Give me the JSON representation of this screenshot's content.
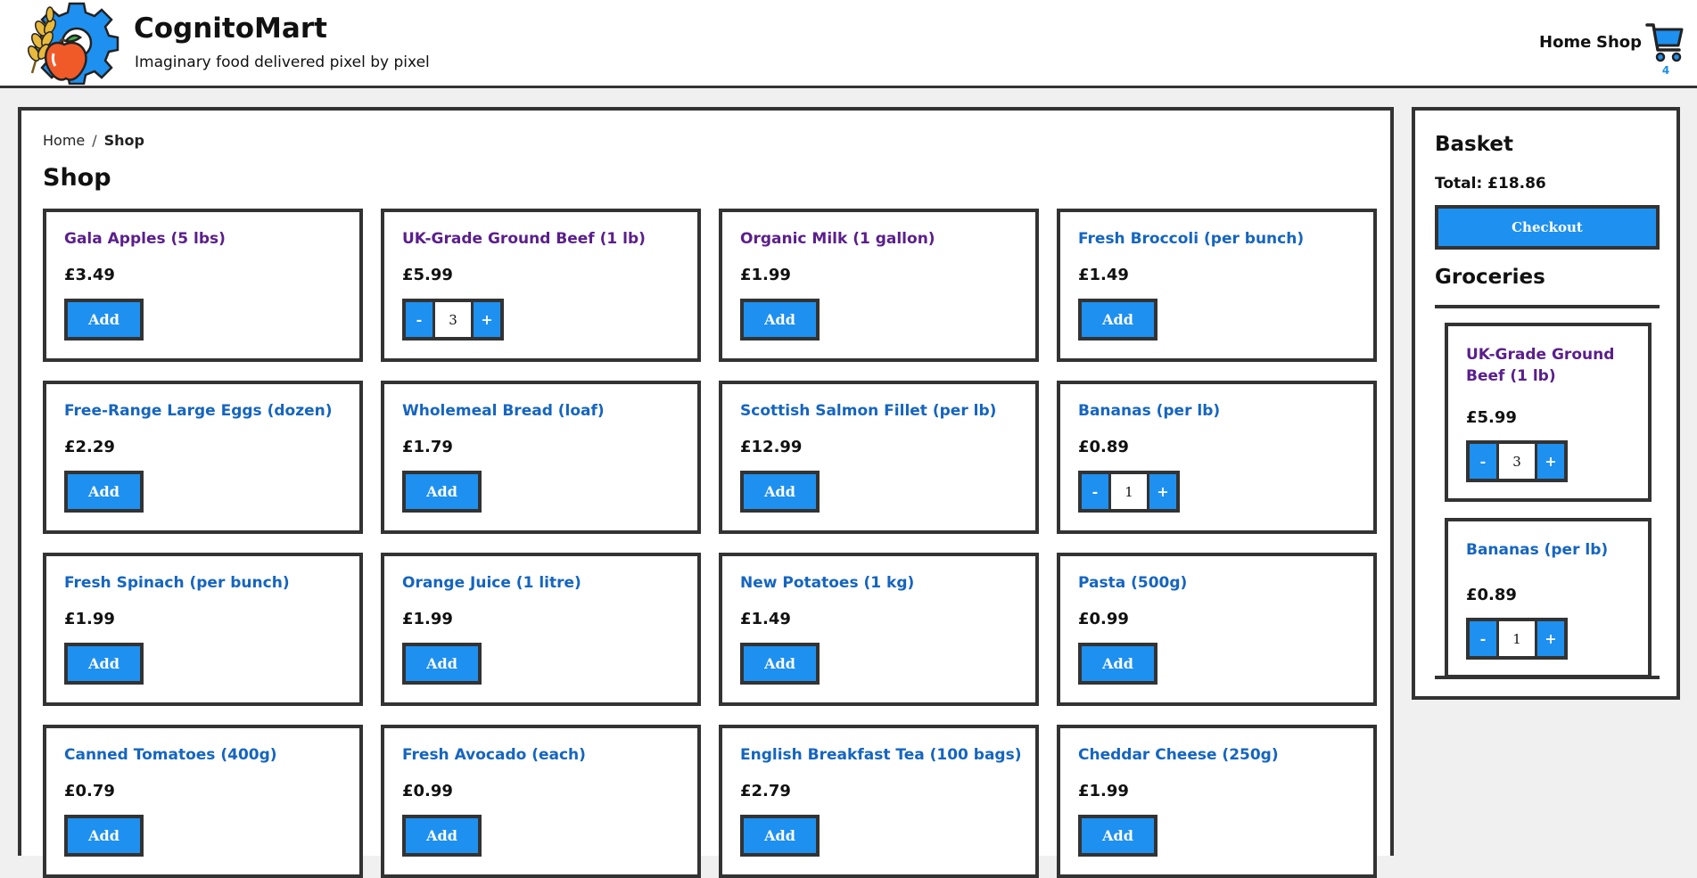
{
  "brand": {
    "title": "CognitoMart",
    "tagline": "Imaginary food delivered pixel by pixel"
  },
  "nav": {
    "home": "Home",
    "shop": "Shop",
    "cart_count": "4"
  },
  "breadcrumb": {
    "home": "Home",
    "separator": "/",
    "current": "Shop"
  },
  "page_title": "Shop",
  "products": [
    {
      "name": "Gala Apples (5 lbs)",
      "price": "£3.49",
      "add_label": "Add",
      "qty": null,
      "visited": true
    },
    {
      "name": "UK-Grade Ground Beef (1 lb)",
      "price": "£5.99",
      "add_label": "Add",
      "qty": "3",
      "visited": true
    },
    {
      "name": "Organic Milk (1 gallon)",
      "price": "£1.99",
      "add_label": "Add",
      "qty": null,
      "visited": true
    },
    {
      "name": "Fresh Broccoli (per bunch)",
      "price": "£1.49",
      "add_label": "Add",
      "qty": null,
      "visited": false
    },
    {
      "name": "Free-Range Large Eggs (dozen)",
      "price": "£2.29",
      "add_label": "Add",
      "qty": null,
      "visited": false
    },
    {
      "name": "Wholemeal Bread (loaf)",
      "price": "£1.79",
      "add_label": "Add",
      "qty": null,
      "visited": false
    },
    {
      "name": "Scottish Salmon Fillet (per lb)",
      "price": "£12.99",
      "add_label": "Add",
      "qty": null,
      "visited": false
    },
    {
      "name": "Bananas (per lb)",
      "price": "£0.89",
      "add_label": "Add",
      "qty": "1",
      "visited": false
    },
    {
      "name": "Fresh Spinach (per bunch)",
      "price": "£1.99",
      "add_label": "Add",
      "qty": null,
      "visited": false
    },
    {
      "name": "Orange Juice (1 litre)",
      "price": "£1.99",
      "add_label": "Add",
      "qty": null,
      "visited": false
    },
    {
      "name": "New Potatoes (1 kg)",
      "price": "£1.49",
      "add_label": "Add",
      "qty": null,
      "visited": false
    },
    {
      "name": "Pasta (500g)",
      "price": "£0.99",
      "add_label": "Add",
      "qty": null,
      "visited": false
    },
    {
      "name": "Canned Tomatoes (400g)",
      "price": "£0.79",
      "add_label": "Add",
      "qty": null,
      "visited": false
    },
    {
      "name": "Fresh Avocado (each)",
      "price": "£0.99",
      "add_label": "Add",
      "qty": null,
      "visited": false
    },
    {
      "name": "English Breakfast Tea (100 bags)",
      "price": "£2.79",
      "add_label": "Add",
      "qty": null,
      "visited": false
    },
    {
      "name": "Cheddar Cheese (250g)",
      "price": "£1.99",
      "add_label": "Add",
      "qty": null,
      "visited": false
    }
  ],
  "stepper": {
    "minus": "-",
    "plus": "+"
  },
  "basket": {
    "title": "Basket",
    "total": "Total: £18.86",
    "checkout_label": "Checkout",
    "groceries_title": "Groceries",
    "items": [
      {
        "name": "UK-Grade Ground Beef (1 lb)",
        "price": "£5.99",
        "qty": "3",
        "visited": true
      },
      {
        "name": "Bananas (per lb)",
        "price": "£0.89",
        "qty": "1",
        "visited": false
      }
    ]
  },
  "colors": {
    "accent": "#1e90f0",
    "link": "#1565c0",
    "link_visited": "#5a1f8c",
    "border": "#333333",
    "page_bg": "#f0f0f0"
  },
  "icons": {
    "logo": "gear-wheat-apple-logo",
    "cart": "shopping-cart-icon"
  }
}
